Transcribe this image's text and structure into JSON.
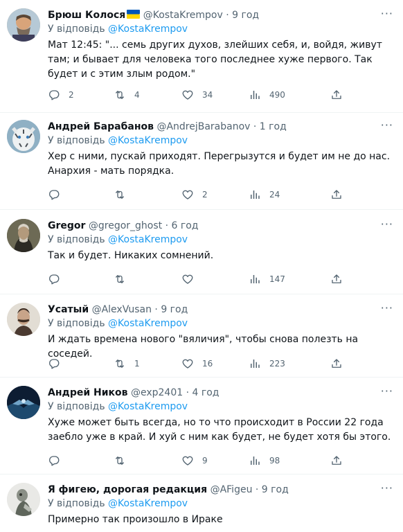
{
  "tweets": [
    {
      "name": "Брюш Колося",
      "handle": "@KostaKrempov",
      "time": "9 год",
      "reply_prefix": "У відповідь",
      "reply_to": "@KostaKrempov",
      "text": "Мат 12:45: \"... семь других духов, злейших себя, и, войдя, живут там; и бывает для человека того последнее хуже первого. Так будет и с этим злым родом.\"",
      "replies": "2",
      "retweets": "4",
      "likes": "34",
      "views": "490"
    },
    {
      "name": "Андрей Барабанов",
      "handle": "@AndrejBarabanov",
      "time": "1 год",
      "reply_prefix": "У відповідь",
      "reply_to": "@KostaKrempov",
      "text": "Хер с ними, пускай приходят. Перегрызутся и будет им не до нас. Анархия - мать порядка.",
      "replies": "",
      "retweets": "",
      "likes": "2",
      "views": "24"
    },
    {
      "name": "Gregor",
      "handle": "@gregor_ghost",
      "time": "6 год",
      "reply_prefix": "У відповідь",
      "reply_to": "@KostaKrempov",
      "text": "Так и будет. Никаких сомнений.",
      "replies": "",
      "retweets": "",
      "likes": "",
      "views": "147"
    },
    {
      "name": "Усатый",
      "handle": "@AlexVusan",
      "time": "9 год",
      "reply_prefix": "У відповідь",
      "reply_to": "@KostaKrempov",
      "text": "И ждать времена нового \"вяличия\", чтобы снова полезть на соседей.",
      "replies": "",
      "retweets": "1",
      "likes": "16",
      "views": "223"
    },
    {
      "name": "Андрей Ников",
      "handle": "@exp2401",
      "time": "4 год",
      "reply_prefix": "У відповідь",
      "reply_to": "@KostaKrempov",
      "text": "Хуже может быть всегда, но то что происходит в России 22 года заебло уже в край. И хуй с ним как будет, не будет хотя бы этого.",
      "replies": "",
      "retweets": "",
      "likes": "9",
      "views": "98"
    },
    {
      "name": "Я фигею, дорогая редакция",
      "handle": "@AFigeu",
      "time": "9 год",
      "reply_prefix": "У відповідь",
      "reply_to": "@KostaKrempov",
      "text": "Примерно так произошло в Ираке",
      "replies": "",
      "retweets": "",
      "likes": "",
      "views": ""
    }
  ],
  "icons": {
    "reply": "reply-bubble-icon",
    "retweet": "retweet-arrows-icon",
    "like": "heart-icon",
    "views": "views-bar-chart-icon",
    "share": "share-upload-icon",
    "more": "more-dots-icon",
    "flag": "ukraine-flag-icon"
  },
  "colors": {
    "accent": "#1d9bf0",
    "muted": "#536471",
    "text": "#0f1419",
    "divider": "#eff3f4",
    "flag_blue": "#0057b7",
    "flag_yellow": "#ffd700"
  }
}
